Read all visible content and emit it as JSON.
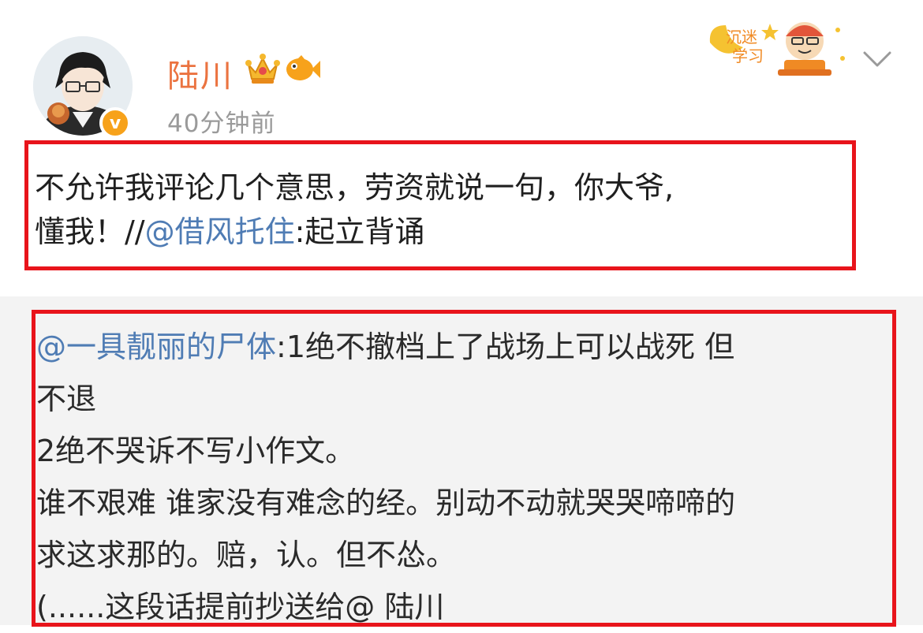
{
  "post": {
    "author": "陆川",
    "time": "40分钟前",
    "verified_badge": "v",
    "text": {
      "line1": "不允许我评论几个意思，劳资就说一句，你大爷,",
      "line2_prefix": "懂我！//",
      "line2_mention": "@借风托住",
      "line2_suffix": ":起立背诵"
    },
    "sticker_text": "沉迷学习"
  },
  "repost": {
    "mention": "@一具靓丽的尸体",
    "line1_rest": ":1绝不撤档上了战场上可以战死 但",
    "line2": "不退",
    "line3": "2绝不哭诉不写小作文。",
    "line4": "谁不艰难 谁家没有难念的经。别动不动就哭哭啼啼的",
    "line5": "求这求那的。赔，认。但不怂。",
    "line6": "(......这段话提前抄送给@ 陆川"
  },
  "colors": {
    "username": "#eb7340",
    "mention": "#4f7cb4",
    "highlight_box": "#e8141b",
    "repost_bg": "#f3f3f3",
    "timestamp": "#9a9a9a"
  },
  "icons": [
    "avatar",
    "verified-badge-icon",
    "crown-icon",
    "fish-icon",
    "chevron-down-icon",
    "sticker-icon"
  ]
}
